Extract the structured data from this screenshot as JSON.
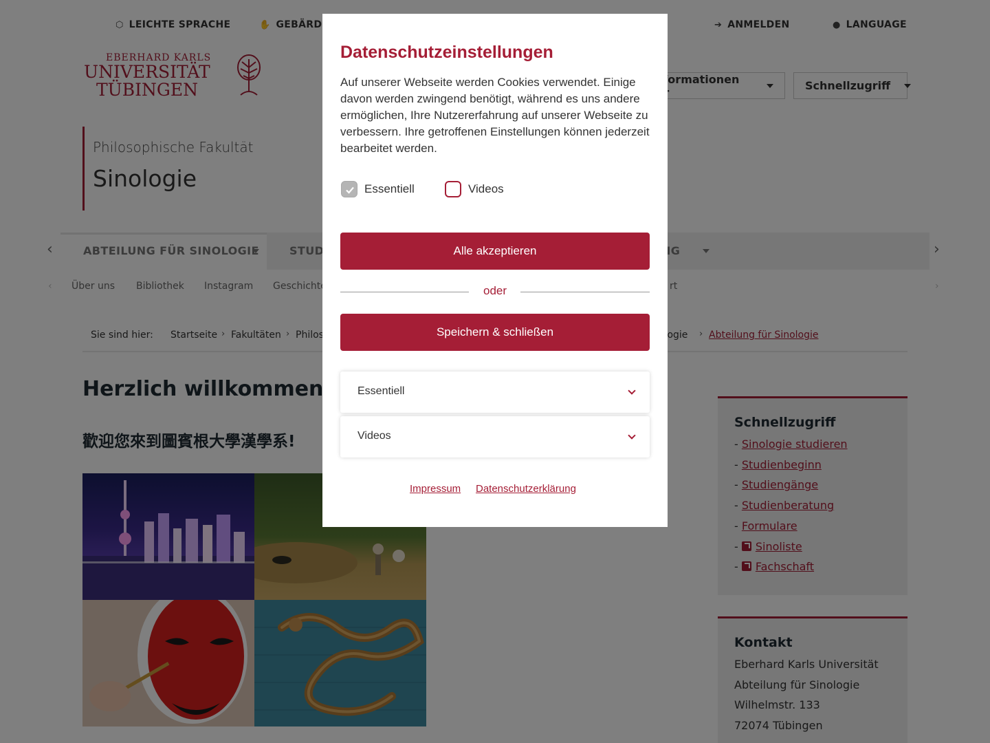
{
  "topbar": {
    "leichte_sprache": "LEICHTE SPRACHE",
    "gebaerden": "GEBÄRDEN",
    "anmelden": "ANMELDEN",
    "language": "LANGUAGE"
  },
  "logo": {
    "line1": "EBERHARD KARLS",
    "line2": "UNIVERSITÄT",
    "line3": "TÜBINGEN"
  },
  "header": {
    "informationen": "Informationen für",
    "schnellzugriff": "Schnellzugriff"
  },
  "faculty": {
    "name": "Philosophische Fakultät",
    "department": "Sinologie"
  },
  "mainnav": {
    "items": [
      "ABTEILUNG FÜR SINOLOGIE",
      "STUDI",
      "NG"
    ]
  },
  "subnav": {
    "items": [
      "Über uns",
      "Bibliothek",
      "Instagram",
      "Geschichte",
      "rt"
    ]
  },
  "breadcrumb": {
    "label": "Sie sind hier:",
    "items": [
      "Startseite",
      "Fakultäten",
      "Philos",
      "ologie",
      "Abteilung für Sinologie"
    ]
  },
  "content": {
    "heading": "Herzlich willkommen be",
    "subheading": "歡迎您來到圖賓根大學漢學系!"
  },
  "sidebar": {
    "quick": {
      "title": "Schnellzugriff",
      "links": [
        "Sinologie studieren",
        "Studienbeginn",
        "Studiengänge",
        "Studienberatung",
        "Formulare",
        "Sinoliste",
        "Fachschaft"
      ]
    },
    "contact": {
      "title": "Kontakt",
      "lines": [
        "Eberhard Karls Universität",
        "Abteilung für Sinologie",
        "Wilhelmstr. 133",
        "72074 Tübingen"
      ]
    }
  },
  "modal": {
    "title": "Datenschutzeinstellungen",
    "text": "Auf unserer Webseite werden Cookies verwendet. Einige davon werden zwingend benötigt, während es uns andere ermöglichen, Ihre Nutzererfahrung auf unserer Webseite zu verbessern. Ihre getroffenen Einstellungen können jederzeit bearbeitet werden.",
    "check_essentiell": "Essentiell",
    "check_videos": "Videos",
    "accept_all": "Alle akzeptieren",
    "oder": "oder",
    "save_close": "Speichern & schließen",
    "accordion_essentiell": "Essentiell",
    "accordion_videos": "Videos",
    "impressum": "Impressum",
    "datenschutz": "Datenschutzerklärung"
  },
  "colors": {
    "brand": "#a51e36"
  }
}
